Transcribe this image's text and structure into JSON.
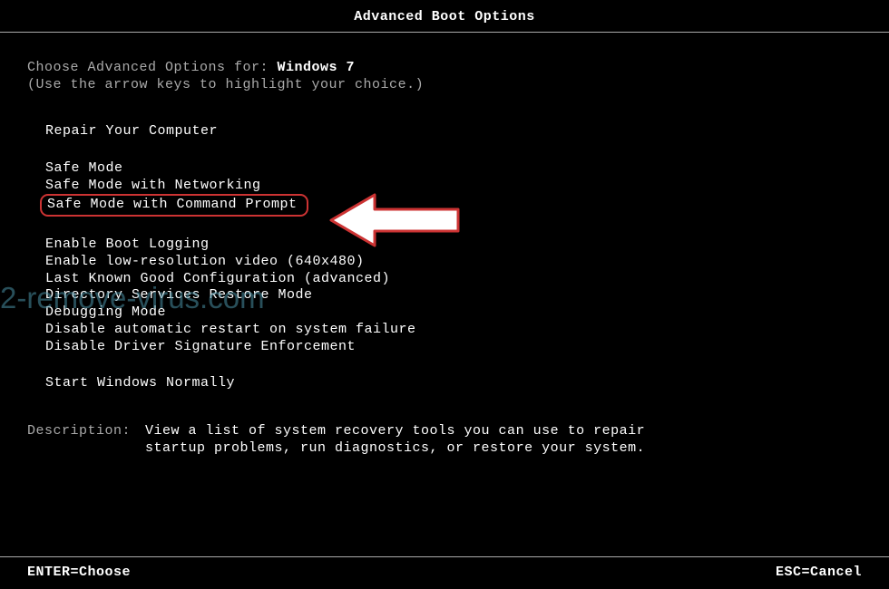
{
  "title": "Advanced Boot Options",
  "choose_prefix": "Choose Advanced Options for: ",
  "os_name": "Windows 7",
  "hint": "(Use the arrow keys to highlight your choice.)",
  "menu": {
    "repair": "Repair Your Computer",
    "safe_mode": "Safe Mode",
    "safe_mode_net": "Safe Mode with Networking",
    "safe_mode_cmd": "Safe Mode with Command Prompt",
    "boot_log": "Enable Boot Logging",
    "low_res": "Enable low-resolution video (640x480)",
    "lkgc": "Last Known Good Configuration (advanced)",
    "dsrm": "Directory Services Restore Mode",
    "debug": "Debugging Mode",
    "no_restart": "Disable automatic restart on system failure",
    "no_sig": "Disable Driver Signature Enforcement",
    "normal": "Start Windows Normally"
  },
  "desc_label": "Description:",
  "desc_text": "View a list of system recovery tools you can use to repair startup problems, run diagnostics, or restore your system.",
  "footer": {
    "enter": "ENTER=Choose",
    "esc": "ESC=Cancel"
  },
  "watermark": "2-remove-virus.com"
}
